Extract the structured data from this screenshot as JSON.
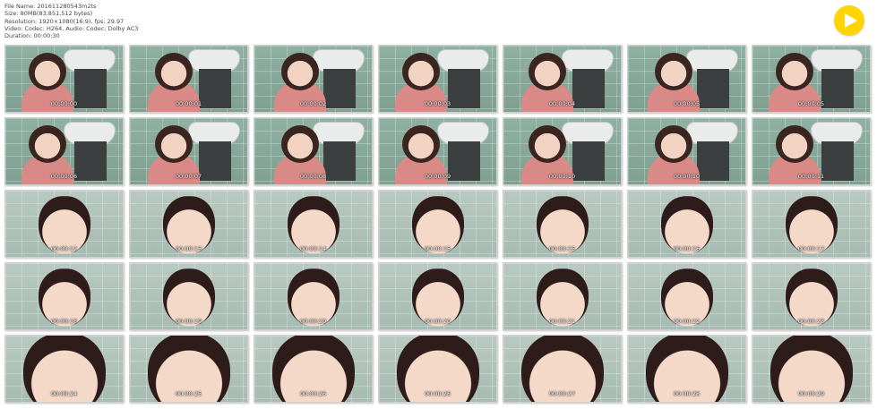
{
  "header": {
    "file_name": "File Name: 201611280543m2ts",
    "size": "Size: 80MB(83,851,512 bytes)",
    "resolution": "Resolution: 1920×1080(16:9), fps: 29.97",
    "video": "Video: Codec: H264, Audio: Codec: Dolby AC3",
    "duration": "Duration: 00:00:30"
  },
  "play_icon": "play-icon",
  "thumbs": [
    "00:00:00",
    "00:00:01",
    "00:00:02",
    "00:00:03",
    "00:00:04",
    "00:00:05",
    "00:00:05",
    "00:00:06",
    "00:00:07",
    "00:00:08",
    "00:00:09",
    "00:00:10",
    "00:00:10",
    "00:00:11",
    "00:00:12",
    "00:00:13",
    "00:00:14",
    "00:00:15",
    "00:00:15",
    "00:00:16",
    "00:00:17",
    "00:00:18",
    "00:00:19",
    "00:00:20",
    "00:00:20",
    "00:00:21",
    "00:00:22",
    "00:00:23",
    "00:00:24",
    "00:00:25",
    "00:00:26",
    "00:00:26",
    "00:00:27",
    "00:00:28",
    "00:00:29"
  ]
}
